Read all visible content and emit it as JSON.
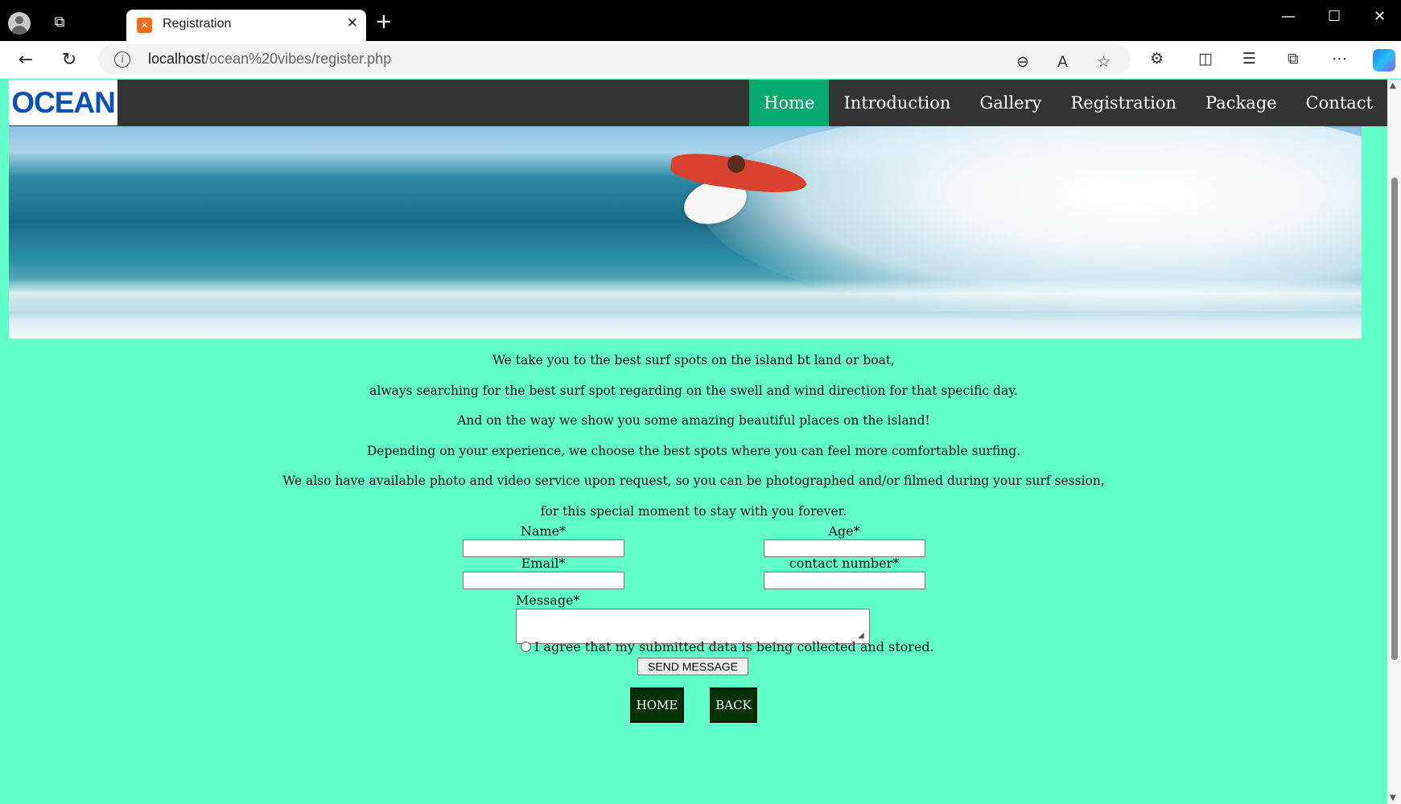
{
  "browser": {
    "tab_title": "Registration",
    "tab_close": "✕",
    "new_tab": "+",
    "url_host": "localhost",
    "url_path": "/ocean%20vibes/register.php",
    "window_controls": {
      "minimize": "—",
      "maximize": "☐",
      "close": "✕"
    }
  },
  "site": {
    "logo_text": "OCEAN",
    "nav": [
      "Home",
      "Introduction",
      "Gallery",
      "Registration",
      "Package",
      "Contact"
    ],
    "active_nav": "Home",
    "colors": {
      "nav_bg": "#333333",
      "active": "#04AA6D",
      "page_bg": "#62FFCB",
      "button_bg": "#003300",
      "logo": "#0E4FB5"
    }
  },
  "intro": {
    "lines": [
      "We take you to the best surf  spots on the island bt land or boat,",
      "always searching for the best surf  spot regarding on the swell and wind direction for that specific day.",
      "And on the way we show you some amazing beautiful places on the island!",
      "Depending on your experience, we choose the best spots where you can feel more comfortable surfing.",
      "We also have available photo and video service upon request, so you can be photographed and/or filmed during your surf  session,",
      "for this special moment to stay with you forever."
    ]
  },
  "form": {
    "name_label": "Name*",
    "age_label": "Age*",
    "email_label": "Email*",
    "contact_label": "contact number*",
    "message_label": "Message*",
    "agree_text": "I agree that my submitted data is being collected and stored.",
    "send_label": "SEND MESSAGE",
    "home_label": "HOME",
    "back_label": "BACK"
  }
}
